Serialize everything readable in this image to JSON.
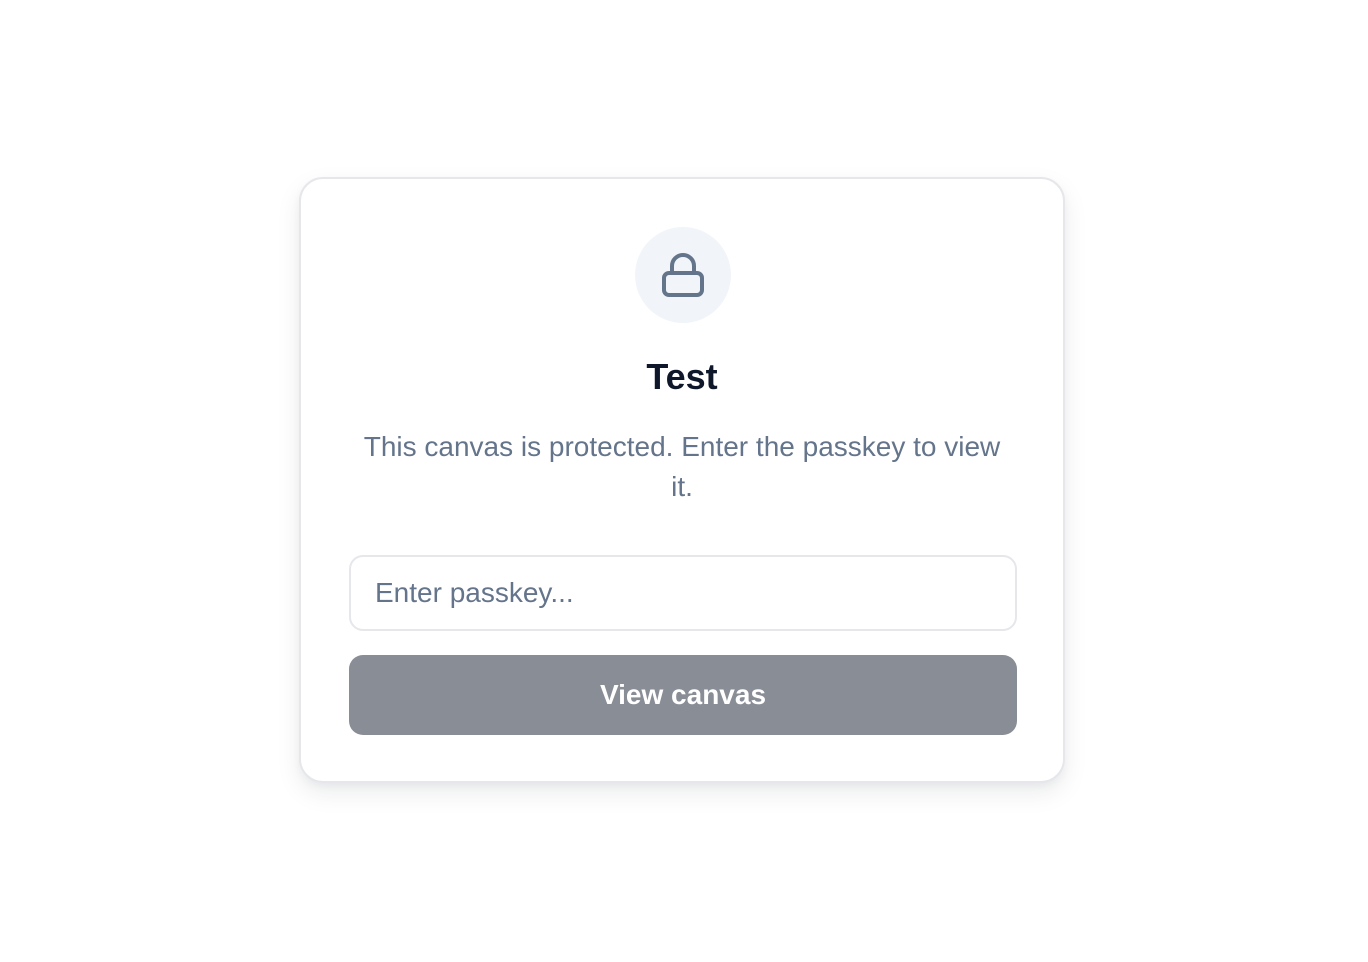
{
  "card": {
    "icon": "lock-icon",
    "title": "Test",
    "description": "This canvas is protected. Enter the passkey to view it.",
    "passkey_input": {
      "value": "",
      "placeholder": "Enter passkey..."
    },
    "submit_label": "View canvas"
  },
  "colors": {
    "title": "#0f172a",
    "text_muted": "#64748b",
    "icon_bg": "#f1f5f9",
    "icon_stroke": "#64748b",
    "button_bg": "#898d96",
    "border": "#e5e7eb"
  }
}
